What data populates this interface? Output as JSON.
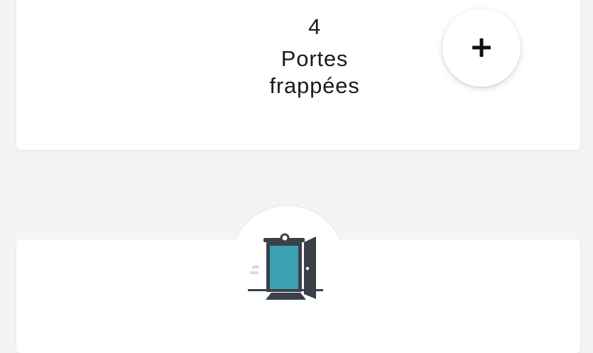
{
  "stat": {
    "count": "4",
    "label": "Portes frappées"
  },
  "actions": {
    "add_icon": "plus-icon"
  },
  "illustration": {
    "icon": "open-door-icon"
  },
  "colors": {
    "background": "#f4f4f6",
    "card": "#ffffff",
    "text": "#1c1c1c",
    "door_teal": "#3aa0b4",
    "door_dark": "#3a4048"
  }
}
